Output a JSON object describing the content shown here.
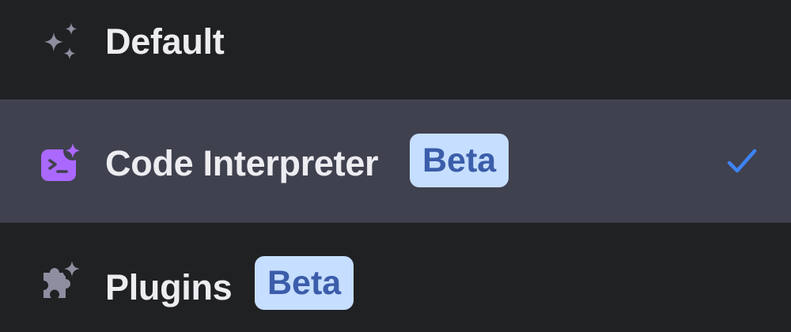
{
  "menu": {
    "items": [
      {
        "label": "Default",
        "icon": "sparkle-icon",
        "selected": false
      },
      {
        "label": "Code Interpreter",
        "badge": "Beta",
        "icon": "code-interpreter-icon",
        "selected": true
      },
      {
        "label": "Plugins",
        "badge": "Beta",
        "icon": "puzzle-icon",
        "selected": false
      }
    ],
    "check_icon": "checkmark-icon"
  },
  "colors": {
    "background": "#202123",
    "selected_background": "#40414f",
    "text": "#ececf1",
    "badge_background": "#c6deff",
    "badge_text": "#3b5daa",
    "accent_purple": "#ab68ff",
    "check_blue": "#3d84f5",
    "icon_gray": "#8e8ea0"
  }
}
